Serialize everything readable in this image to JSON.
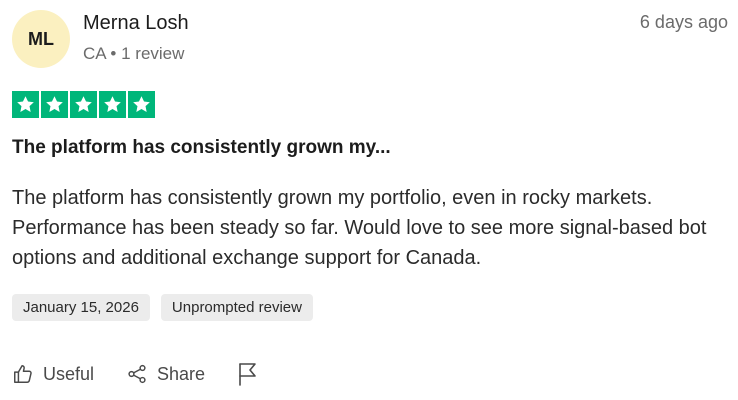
{
  "review": {
    "avatar_initials": "ML",
    "reviewer_name": "Merna Losh",
    "country": "CA",
    "separator": "•",
    "review_count": "1 review",
    "posted_ago": "6 days ago",
    "rating": 5,
    "rating_max": 5,
    "star_color": "#00b67a",
    "title": "The platform has consistently grown my...",
    "body": "The platform has consistently grown my portfolio, even in rocky markets. Performance has been steady so far. Would love to see more signal-based bot options and additional exchange support for Canada.",
    "experience_date": "January 15, 2026",
    "review_type": "Unprompted review"
  },
  "actions": {
    "useful_label": "Useful",
    "share_label": "Share",
    "useful_icon": "thumbs-up-icon",
    "share_icon": "share-icon",
    "flag_icon": "flag-icon"
  }
}
